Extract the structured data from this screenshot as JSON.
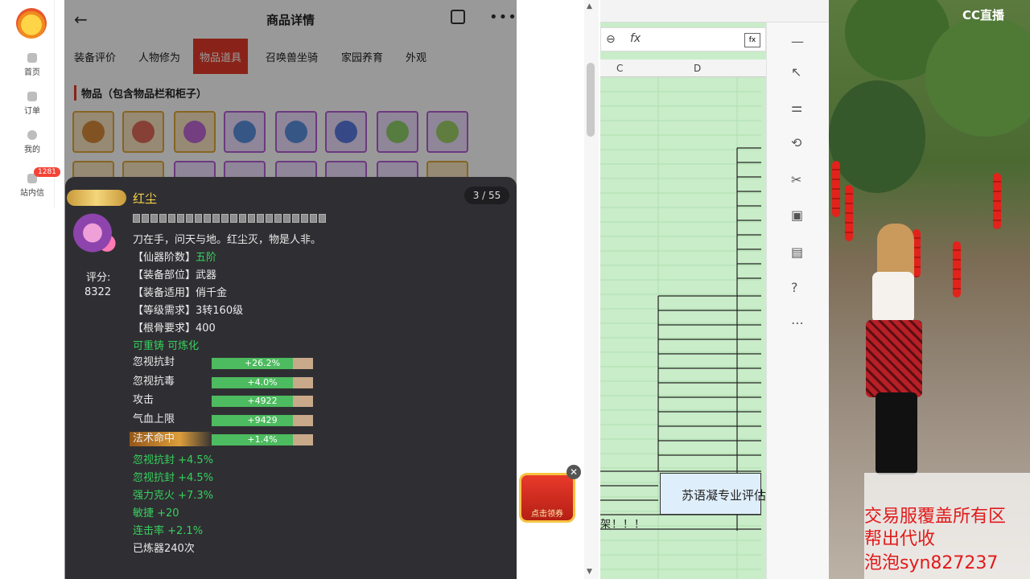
{
  "left_nav": {
    "items": [
      {
        "label": "首页"
      },
      {
        "label": "订单"
      },
      {
        "label": "我的"
      },
      {
        "label": "站内信"
      }
    ],
    "badge": "1281"
  },
  "app": {
    "title": "商品详情",
    "tabs": [
      "装备评价",
      "人物修为",
      "物品道具",
      "召唤兽坐骑",
      "家园养育",
      "外观"
    ],
    "active_tab": "物品道具",
    "section_title": "物品（包含物品栏和柜子）"
  },
  "tooltip": {
    "name": "红尘",
    "page": "3 / 55",
    "score_label": "评分:",
    "score_value": "8322",
    "desc": "刀在手，问天与地。红尘灭，物是人非。",
    "attrs": [
      {
        "key": "【仙器阶数】",
        "val": "五阶"
      },
      {
        "key": "【装备部位】",
        "val": "武器"
      },
      {
        "key": "【装备适用】",
        "val": "俏千金"
      },
      {
        "key": "【等级需求】",
        "val": "3转160级"
      },
      {
        "key": "【根骨要求】",
        "val": "400"
      }
    ],
    "reforge": "可重铸 可炼化",
    "bars": [
      {
        "label": "忽视抗封",
        "text": "+26.2%",
        "fill": 0.8
      },
      {
        "label": "忽视抗毒",
        "text": "+4.0%",
        "fill": 0.8
      },
      {
        "label": "攻击",
        "text": "+4922",
        "fill": 0.8
      },
      {
        "label": "气血上限",
        "text": "+9429",
        "fill": 0.8
      },
      {
        "label": "法术命中",
        "text": "+1.4%",
        "fill": 0.8
      }
    ],
    "extras": [
      "忽视抗封 +4.5%",
      "忽视抗封 +4.5%",
      "强力克火 +7.3%",
      "敏捷 +20",
      "连击率 +2.1%"
    ],
    "refine": "已炼器240次"
  },
  "coupon": {
    "label": "点击领券"
  },
  "sheet": {
    "columns": [
      "C",
      "D"
    ],
    "fx": "fx",
    "label_cell": "苏语凝专业评估",
    "alert": "架！！！"
  },
  "video": {
    "logo": "CC直播",
    "promo": [
      "交易服覆盖所有区",
      "帮出代收",
      "泡泡syn827237"
    ]
  }
}
